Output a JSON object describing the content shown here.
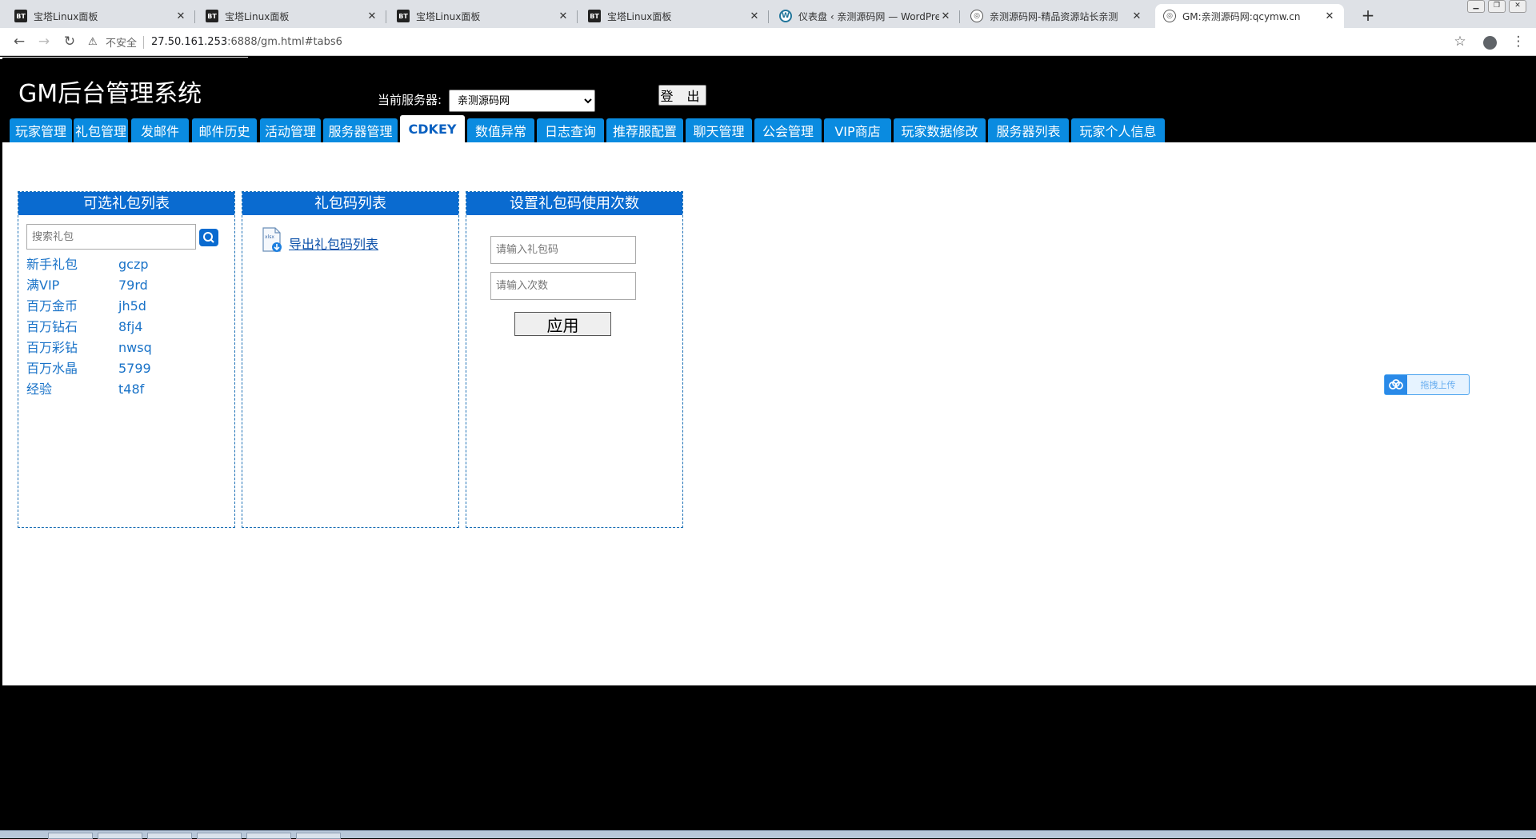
{
  "browser": {
    "tabs": [
      {
        "title": "宝塔Linux面板",
        "favicon": "BT",
        "active": false
      },
      {
        "title": "宝塔Linux面板",
        "favicon": "BT",
        "active": false
      },
      {
        "title": "宝塔Linux面板",
        "favicon": "BT",
        "active": false
      },
      {
        "title": "宝塔Linux面板",
        "favicon": "BT",
        "active": false
      },
      {
        "title": "仪表盘 ‹ 亲测源码网 — WordPre",
        "favicon": "W",
        "active": false
      },
      {
        "title": "亲测源码网-精品资源站长亲测",
        "favicon": "globe",
        "active": false
      },
      {
        "title": "GM:亲测源码网:qcymw.cn",
        "favicon": "globe",
        "active": true
      }
    ],
    "new_tab_label": "+",
    "security_label": "不安全",
    "url_host": "27.50.161.253",
    "url_rest": ":6888/gm.html#tabs6"
  },
  "header": {
    "title": "GM后台管理系统",
    "server_label": "当前服务器:",
    "server_selected": "亲测源码网",
    "logout_label": "登 出"
  },
  "menu": {
    "items": [
      "玩家管理",
      "礼包管理",
      "发邮件",
      "邮件历史",
      "活动管理",
      "服务器管理",
      "CDKEY",
      "数值异常",
      "日志查询",
      "推荐服配置",
      "聊天管理",
      "公会管理",
      "VIP商店",
      "玩家数据修改",
      "服务器列表",
      "玩家个人信息"
    ],
    "active_index": 6
  },
  "panels": {
    "gift_list": {
      "title": "可选礼包列表",
      "search_placeholder": "搜索礼包",
      "items": [
        {
          "name": "新手礼包",
          "code": "gczp"
        },
        {
          "name": "满VIP",
          "code": "79rd"
        },
        {
          "name": "百万金币",
          "code": "jh5d"
        },
        {
          "name": "百万钻石",
          "code": "8fj4"
        },
        {
          "name": "百万彩钻",
          "code": "nwsq"
        },
        {
          "name": "百万水晶",
          "code": "5799"
        },
        {
          "name": "经验",
          "code": "t48f"
        }
      ]
    },
    "code_list": {
      "title": "礼包码列表",
      "export_label": "导出礼包码列表",
      "file_icon_text": "xlsx"
    },
    "usage": {
      "title": "设置礼包码使用次数",
      "code_placeholder": "请输入礼包码",
      "count_placeholder": "请输入次数",
      "apply_label": "应用"
    }
  },
  "upload_widget": {
    "label": "拖拽上传"
  },
  "colors": {
    "menu_tab": "#0a8be0",
    "panel_head": "#0a6bd0",
    "link": "#1a73c8"
  }
}
